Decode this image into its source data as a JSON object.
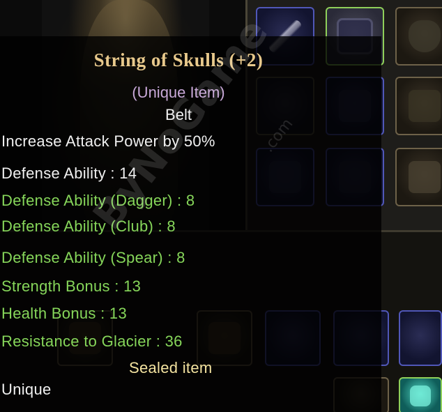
{
  "colors": {
    "title": "#e8c98c",
    "subtitle": "#c8a8d8",
    "white": "#f0f0f0",
    "stat_green": "#86d65a",
    "sealed": "#f4e3a0"
  },
  "item": {
    "name": "String of Skulls (+2)",
    "rarity_label": "(Unique Item)",
    "type": "Belt",
    "effect": "Increase Attack Power by 50%",
    "defense": "Defense Ability : 14",
    "bonuses": [
      "Defense Ability (Dagger) : 8",
      "Defense Ability (Club) : 8",
      "Defense Ability (Spear) : 8",
      "Strength Bonus : 13",
      "Health Bonus : 13",
      "Resistance to Glacier : 36"
    ],
    "sealed": "Sealed item",
    "grade": "Unique"
  },
  "watermark": {
    "brand": "ByNoGame",
    "suffix": ".com"
  },
  "inventory": {
    "slot_icons": [
      "spear-icon",
      "belt-icon",
      "shield-icon",
      "armor-icon",
      "gauntlet-icon",
      "pants-icon",
      "boots-icon",
      "chest-icon",
      "helmet-icon",
      "crystal-icon"
    ]
  }
}
